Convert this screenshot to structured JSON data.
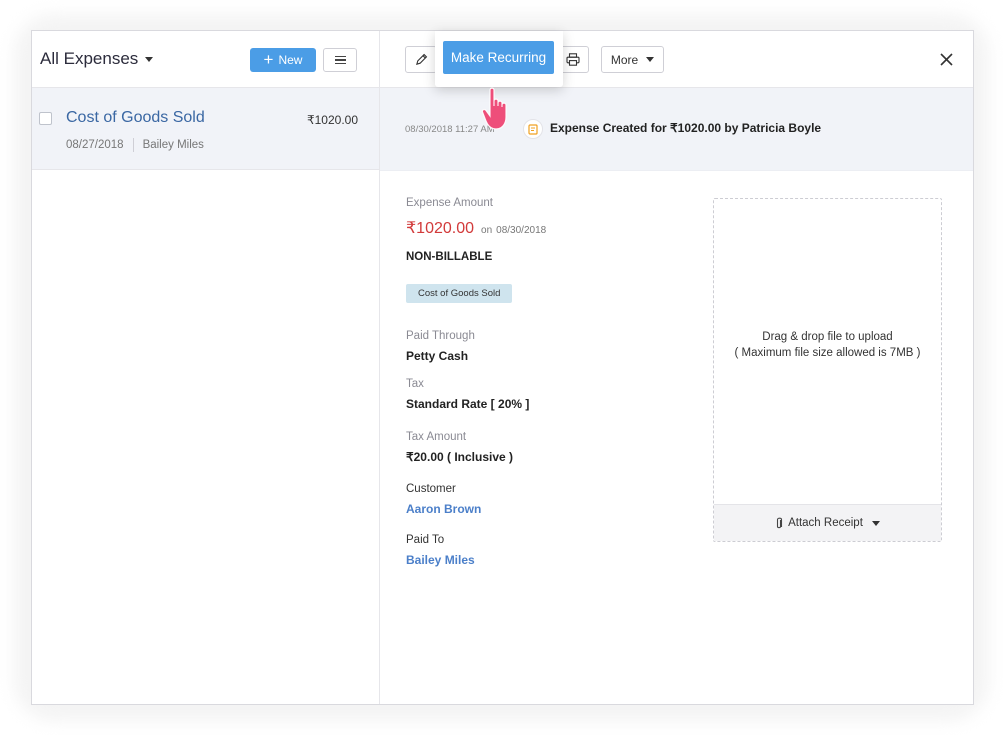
{
  "left": {
    "view_title": "All Expenses",
    "new_label": "New",
    "list": [
      {
        "title": "Cost of Goods Sold",
        "amount": "₹1020.00",
        "date": "08/27/2018",
        "vendor": "Bailey Miles"
      }
    ]
  },
  "toolbar": {
    "recurring_label": "Make Recurring",
    "more_label": "More"
  },
  "activity": {
    "time": "08/30/2018 11:27 AM",
    "text": "Expense Created for ₹1020.00 by Patricia Boyle"
  },
  "detail": {
    "amount_label": "Expense Amount",
    "amount": "₹1020.00",
    "on_text": "on",
    "amount_date": "08/30/2018",
    "billable": "NON-BILLABLE",
    "category_tag": "Cost of Goods Sold",
    "paid_through_label": "Paid Through",
    "paid_through": "Petty Cash",
    "tax_label": "Tax",
    "tax": "Standard Rate [ 20% ]",
    "tax_amount_label": "Tax Amount",
    "tax_amount": "₹20.00 ( Inclusive )",
    "customer_label": "Customer",
    "customer": "Aaron Brown",
    "paid_to_label": "Paid To",
    "paid_to": "Bailey Miles"
  },
  "receipt": {
    "drop_line1": "Drag & drop file to upload",
    "drop_line2": "( Maximum file size allowed is 7MB )",
    "attach_label": "Attach Receipt"
  },
  "colors": {
    "accent": "#4b9de6",
    "link": "#4b7fc9",
    "amount_red": "#d23a3a",
    "cursor_pink": "#ee4e7a"
  },
  "icons": [
    "caret-down-icon",
    "plus-icon",
    "hamburger-icon",
    "pencil-icon",
    "printer-icon",
    "close-icon",
    "note-icon",
    "paperclip-icon",
    "hand-pointer-icon"
  ]
}
